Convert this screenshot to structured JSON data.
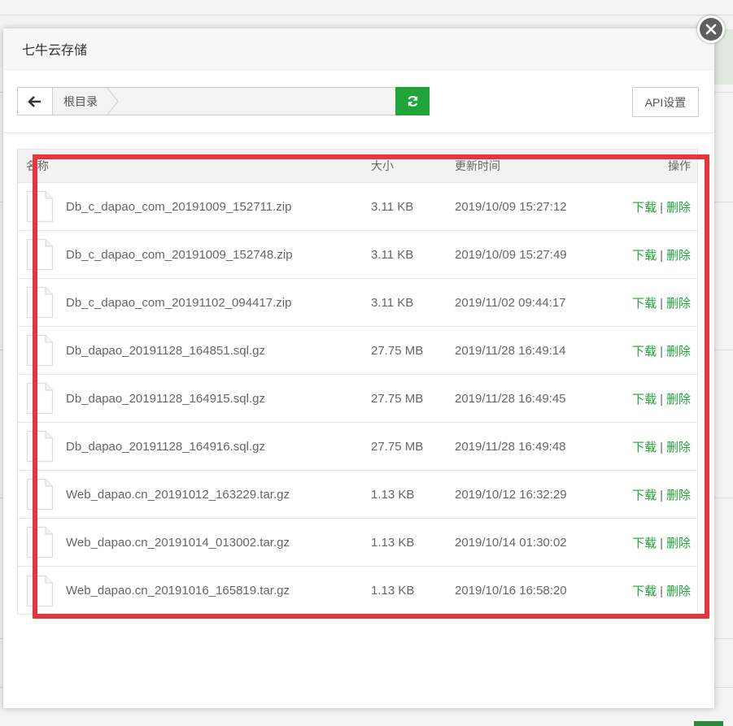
{
  "modal": {
    "title": "七牛云存储",
    "close_icon": "close-icon"
  },
  "toolbar": {
    "back_icon": "arrow-left-icon",
    "breadcrumb": [
      "根目录"
    ],
    "refresh_icon": "refresh-icon",
    "api_button_label": "API设置"
  },
  "table": {
    "headers": {
      "name": "名称",
      "size": "大小",
      "time": "更新时间",
      "ops": "操作"
    },
    "rows": [
      {
        "name": "Db_c_dapao_com_20191009_152711.zip",
        "size": "3.11 KB",
        "time": "2019/10/09 15:27:12"
      },
      {
        "name": "Db_c_dapao_com_20191009_152748.zip",
        "size": "3.11 KB",
        "time": "2019/10/09 15:27:49"
      },
      {
        "name": "Db_c_dapao_com_20191102_094417.zip",
        "size": "3.11 KB",
        "time": "2019/11/02 09:44:17"
      },
      {
        "name": "Db_dapao_20191128_164851.sql.gz",
        "size": "27.75 MB",
        "time": "2019/11/28 16:49:14"
      },
      {
        "name": "Db_dapao_20191128_164915.sql.gz",
        "size": "27.75 MB",
        "time": "2019/11/28 16:49:45"
      },
      {
        "name": "Db_dapao_20191128_164916.sql.gz",
        "size": "27.75 MB",
        "time": "2019/11/28 16:49:48"
      },
      {
        "name": "Web_dapao.cn_20191012_163229.tar.gz",
        "size": "1.13 KB",
        "time": "2019/10/12 16:32:29"
      },
      {
        "name": "Web_dapao.cn_20191014_013002.tar.gz",
        "size": "1.13 KB",
        "time": "2019/10/14 01:30:02"
      },
      {
        "name": "Web_dapao.cn_20191016_165819.tar.gz",
        "size": "1.13 KB",
        "time": "2019/10/16 16:58:20"
      }
    ],
    "download_label": "下载",
    "separator": "|",
    "delete_label": "删除",
    "file_icon": "file-icon"
  },
  "colors": {
    "accent_green": "#20a53a",
    "highlight_red": "#e8343b"
  }
}
